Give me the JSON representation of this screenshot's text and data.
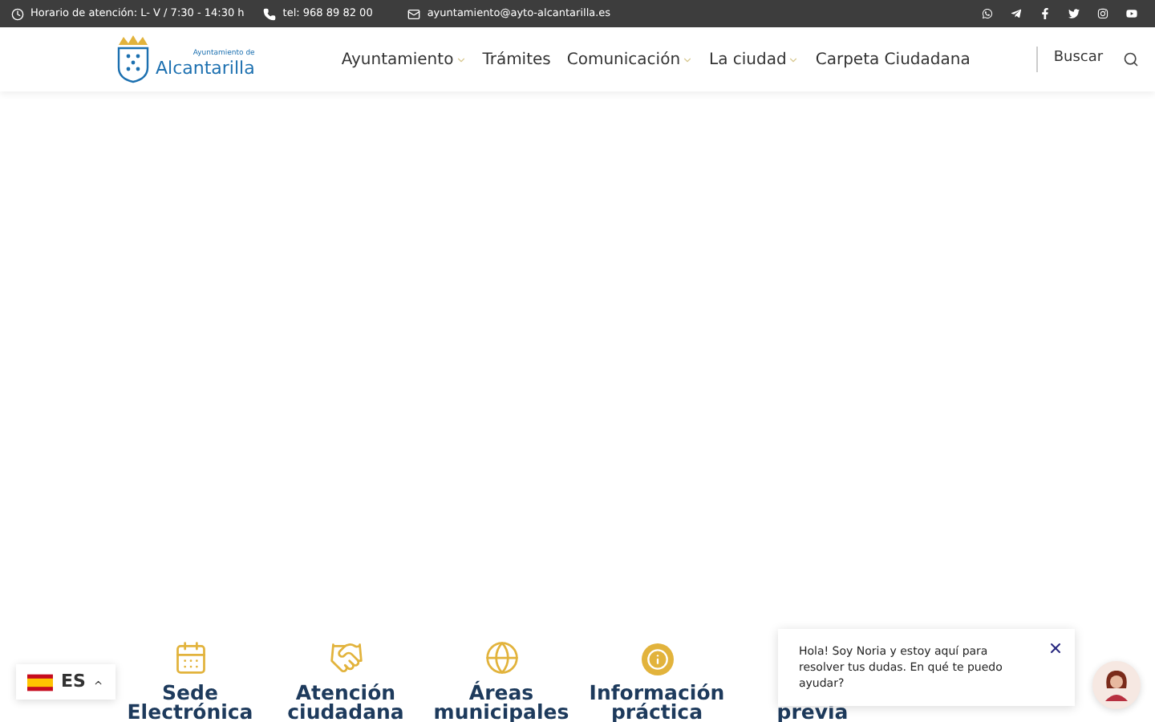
{
  "top_bar": {
    "hours": "Horario de atención: L- V / 7:30 - 14:30 h",
    "phone": "tel: 968 89 82 00",
    "email": "ayuntamiento@ayto-alcantarilla.es"
  },
  "header": {
    "logo_small": "Ayuntamiento de",
    "logo_big": "Alcantarilla",
    "nav": [
      {
        "label": "Ayuntamiento",
        "dropdown": true
      },
      {
        "label": "Trámites",
        "dropdown": false
      },
      {
        "label": "Comunicación",
        "dropdown": true
      },
      {
        "label": "La ciudad",
        "dropdown": true
      },
      {
        "label": "Carpeta Ciudadana",
        "dropdown": false
      }
    ],
    "search": "Buscar"
  },
  "quick_links": [
    {
      "lines": [
        "Sede",
        "Electrónica"
      ]
    },
    {
      "lines": [
        "Atención",
        "ciudadana"
      ]
    },
    {
      "lines": [
        "Áreas",
        "municipales"
      ]
    },
    {
      "lines": [
        "Información",
        "práctica"
      ]
    },
    {
      "lines": [
        "previa"
      ]
    }
  ],
  "language": {
    "code": "ES"
  },
  "chat": {
    "message": "Hola! Soy Noria y estoy aquí para resolver tus dudas. En qué te puedo ayudar?"
  }
}
